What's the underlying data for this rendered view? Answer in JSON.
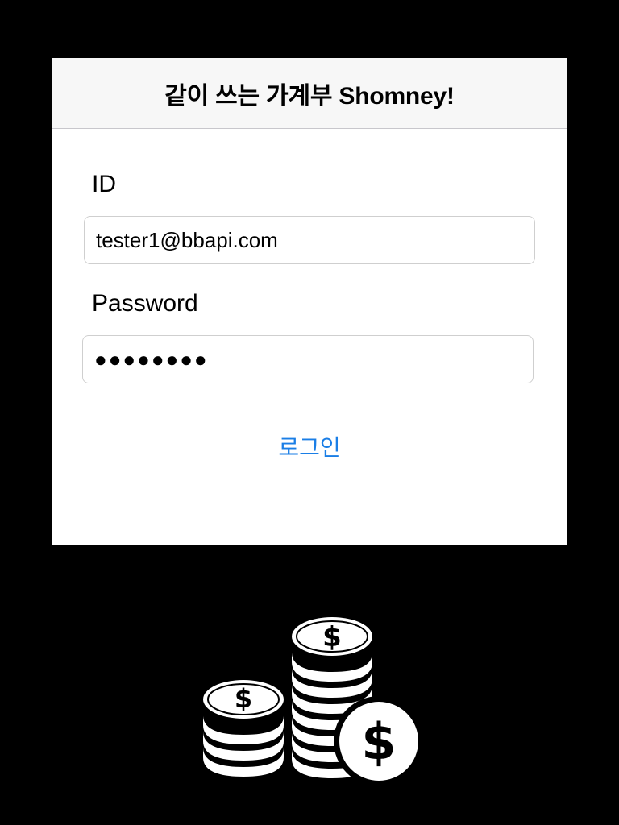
{
  "app": {
    "title": "같이 쓰는 가계부 Shomney!"
  },
  "login_form": {
    "id_label": "ID",
    "id_value": "tester1@bbapi.com",
    "password_label": "Password",
    "password_value": "●●●●●●●●",
    "login_button": "로그인"
  },
  "decoration": {
    "icon": "coin-stack-icon",
    "dollar_glyph": "$"
  },
  "colors": {
    "background": "#000000",
    "panel": "#ffffff",
    "header": "#f7f7f7",
    "link": "#1a7ee6"
  }
}
